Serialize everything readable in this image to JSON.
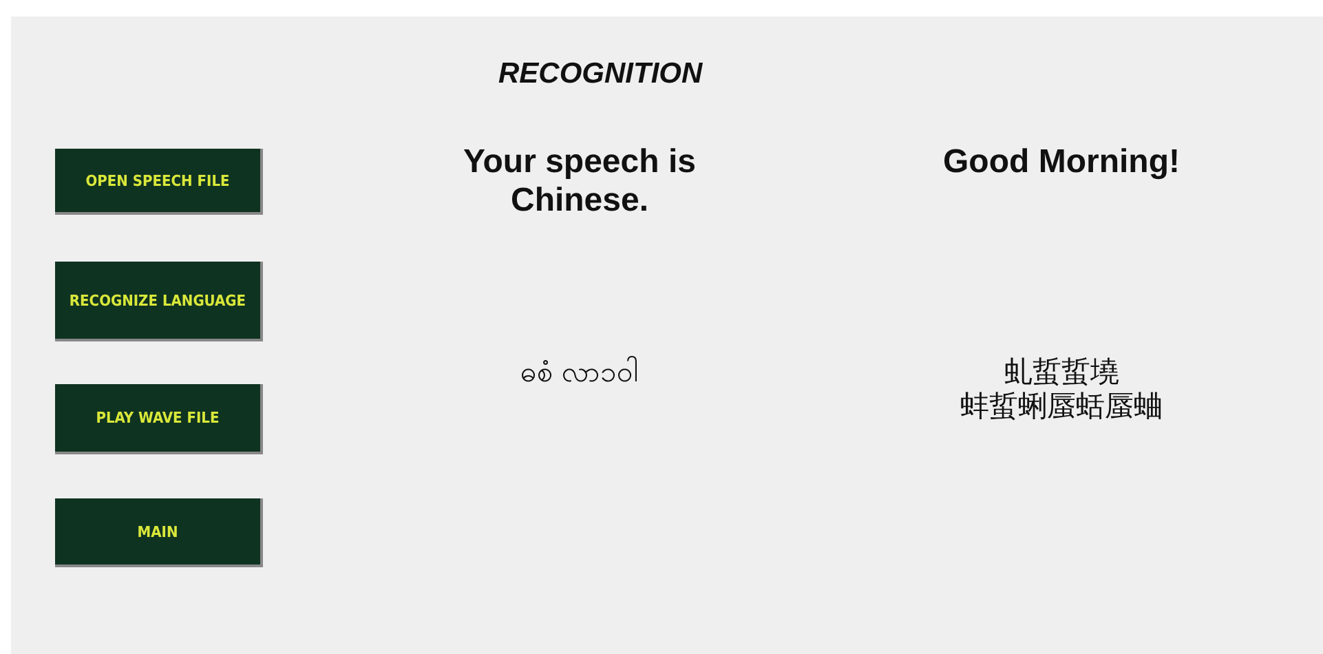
{
  "title": "RECOGNITION",
  "buttons": [
    {
      "label": "OPEN SPEECH FILE"
    },
    {
      "label": "RECOGNIZE LANGUAGE"
    },
    {
      "label": "PLAY WAVE FILE"
    },
    {
      "label": "MAIN"
    }
  ],
  "results": [
    {
      "text": "Your speech is Chinese.",
      "kind": "heading"
    },
    {
      "text": "Good Morning!",
      "kind": "heading"
    },
    {
      "text": "ဓစံ လာ၁၀ါ",
      "kind": "script"
    },
    {
      "lines": [
        "虬蜇蜇墝",
        "蚌蜇蜊蜃蛞蜃蛐"
      ],
      "kind": "script"
    }
  ]
}
